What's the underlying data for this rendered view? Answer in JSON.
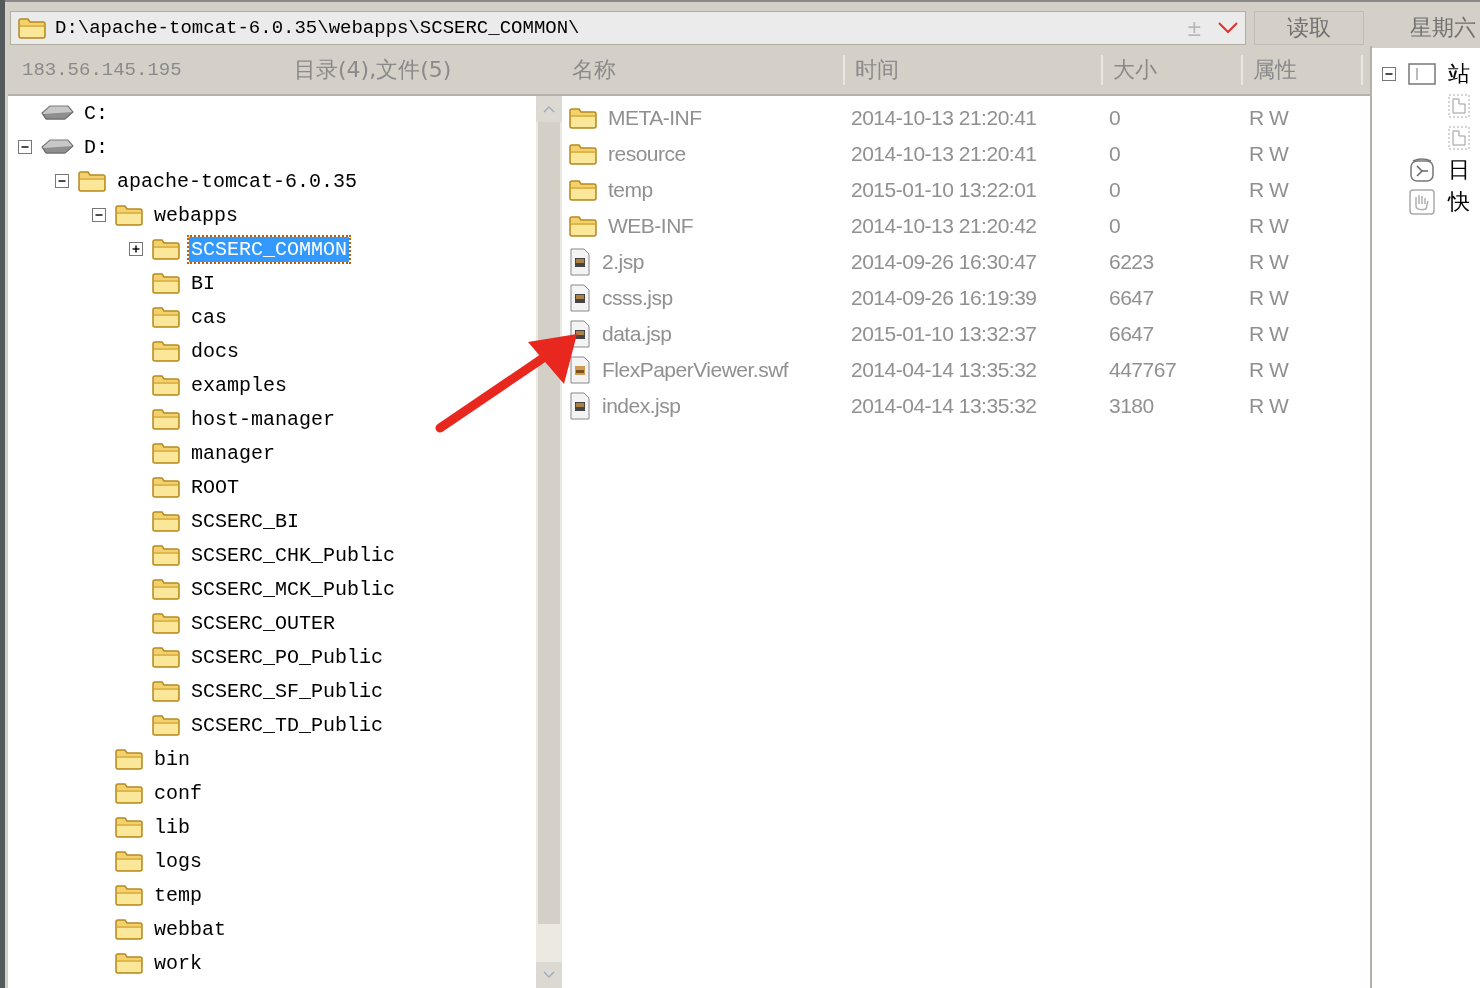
{
  "address_bar": {
    "path": "D:\\apache-tomcat-6.0.35\\webapps\\SCSERC_COMMON\\",
    "plus_minus": "±"
  },
  "read_button": "读取",
  "weekday": "星期六",
  "tree_header": {
    "host": "183.56.145.195",
    "summary": "目录(4),文件(5)"
  },
  "tree": [
    {
      "kind": "drive",
      "label": "C:",
      "selected": false
    },
    {
      "kind": "drive",
      "label": "D:",
      "expanded": true,
      "selected": false,
      "children": [
        {
          "kind": "folder",
          "label": "apache-tomcat-6.0.35",
          "expanded": true,
          "selected": false,
          "children": [
            {
              "kind": "folder",
              "label": "webapps",
              "expanded": true,
              "selected": false,
              "children": [
                {
                  "kind": "folder",
                  "label": "SCSERC_COMMON",
                  "expanded": false,
                  "selected": true
                },
                {
                  "kind": "folder",
                  "label": "BI",
                  "selected": false
                },
                {
                  "kind": "folder",
                  "label": "cas",
                  "selected": false
                },
                {
                  "kind": "folder",
                  "label": "docs",
                  "selected": false
                },
                {
                  "kind": "folder",
                  "label": "examples",
                  "selected": false
                },
                {
                  "kind": "folder",
                  "label": "host-manager",
                  "selected": false
                },
                {
                  "kind": "folder",
                  "label": "manager",
                  "selected": false
                },
                {
                  "kind": "folder",
                  "label": "ROOT",
                  "selected": false
                },
                {
                  "kind": "folder",
                  "label": "SCSERC_BI",
                  "selected": false
                },
                {
                  "kind": "folder",
                  "label": "SCSERC_CHK_Public",
                  "selected": false
                },
                {
                  "kind": "folder",
                  "label": "SCSERC_MCK_Public",
                  "selected": false
                },
                {
                  "kind": "folder",
                  "label": "SCSERC_OUTER",
                  "selected": false
                },
                {
                  "kind": "folder",
                  "label": "SCSERC_PO_Public",
                  "selected": false
                },
                {
                  "kind": "folder",
                  "label": "SCSERC_SF_Public",
                  "selected": false
                },
                {
                  "kind": "folder",
                  "label": "SCSERC_TD_Public",
                  "selected": false
                }
              ]
            },
            {
              "kind": "folder",
              "label": "bin",
              "selected": false
            },
            {
              "kind": "folder",
              "label": "conf",
              "selected": false
            },
            {
              "kind": "folder",
              "label": "lib",
              "selected": false
            },
            {
              "kind": "folder",
              "label": "logs",
              "selected": false
            },
            {
              "kind": "folder",
              "label": "temp",
              "selected": false
            },
            {
              "kind": "folder",
              "label": "webbat",
              "selected": false
            },
            {
              "kind": "folder",
              "label": "work",
              "selected": false
            }
          ]
        }
      ]
    }
  ],
  "file_columns": [
    "名称",
    "时间",
    "大小",
    "属性"
  ],
  "files": [
    {
      "kind": "folder",
      "name": "META-INF",
      "time": "2014-10-13 21:20:41",
      "size": "0",
      "attributes": "R W"
    },
    {
      "kind": "folder",
      "name": "resource",
      "time": "2014-10-13 21:20:41",
      "size": "0",
      "attributes": "R W"
    },
    {
      "kind": "folder",
      "name": "temp",
      "time": "2015-01-10 13:22:01",
      "size": "0",
      "attributes": "R W"
    },
    {
      "kind": "folder",
      "name": "WEB-INF",
      "time": "2014-10-13 21:20:42",
      "size": "0",
      "attributes": "R W"
    },
    {
      "kind": "file",
      "name": "2.jsp",
      "time": "2014-09-26 16:30:47",
      "size": "6223",
      "attributes": "R W"
    },
    {
      "kind": "file",
      "name": "csss.jsp",
      "time": "2014-09-26 16:19:39",
      "size": "6647",
      "attributes": "R W"
    },
    {
      "kind": "file",
      "name": "data.jsp",
      "time": "2015-01-10 13:32:37",
      "size": "6647",
      "attributes": "R W"
    },
    {
      "kind": "swf",
      "name": "FlexPaperViewer.swf",
      "time": "2014-04-14 13:35:32",
      "size": "447767",
      "attributes": "R W"
    },
    {
      "kind": "file",
      "name": "index.jsp",
      "time": "2014-04-14 13:35:32",
      "size": "3180",
      "attributes": "R W"
    }
  ],
  "side_panel": [
    {
      "kind": "site",
      "label": "站",
      "expanded": true
    },
    {
      "kind": "page"
    },
    {
      "kind": "page"
    },
    {
      "kind": "clock",
      "label": "日"
    },
    {
      "kind": "hand",
      "label": "快"
    }
  ]
}
